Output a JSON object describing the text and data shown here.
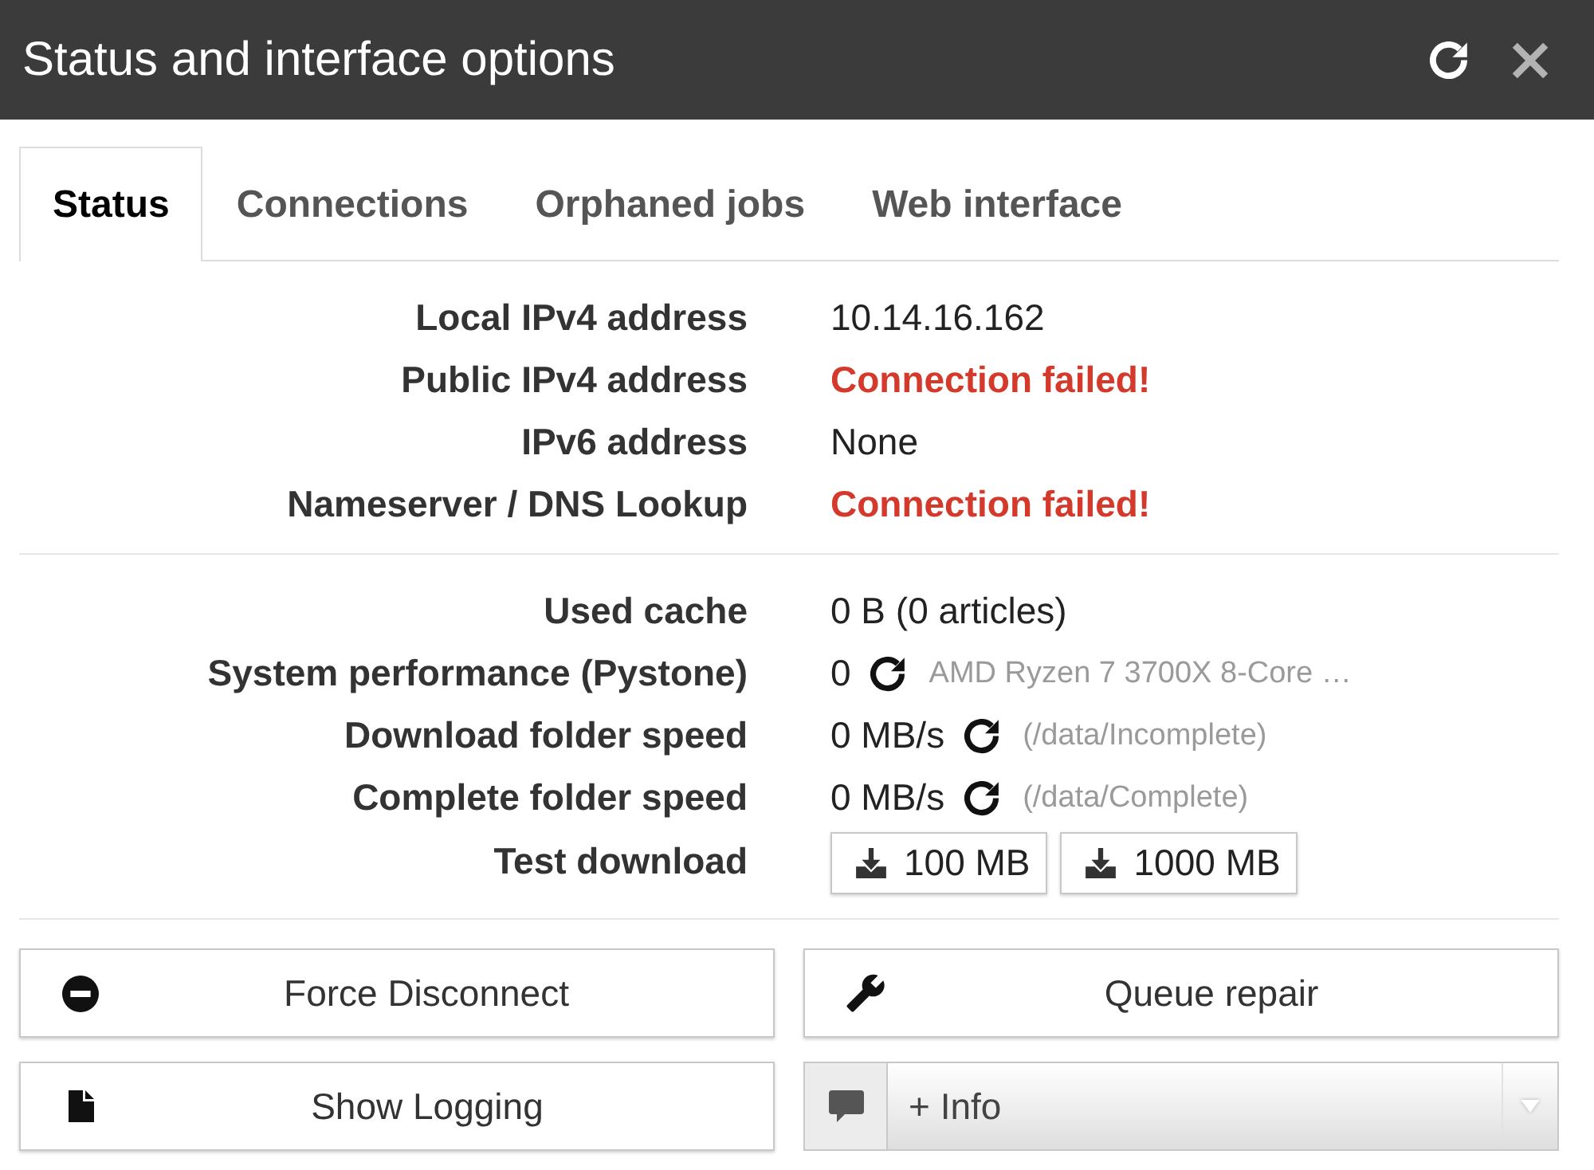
{
  "window": {
    "title": "Status and interface options"
  },
  "tabs": [
    {
      "label": "Status",
      "selected": true
    },
    {
      "label": "Connections",
      "selected": false
    },
    {
      "label": "Orphaned jobs",
      "selected": false
    },
    {
      "label": "Web interface",
      "selected": false
    }
  ],
  "network": [
    {
      "label": "Local IPv4 address",
      "kind": "text",
      "value": "10.14.16.162"
    },
    {
      "label": "Public IPv4 address",
      "kind": "error",
      "value": "Connection failed!"
    },
    {
      "label": "IPv6 address",
      "kind": "text",
      "value": "None"
    },
    {
      "label": "Nameserver / DNS Lookup",
      "kind": "error",
      "value": "Connection failed!"
    }
  ],
  "performance": [
    {
      "label": "Used cache",
      "kind": "text",
      "value": "0 B (0 articles)"
    },
    {
      "label": "System performance (Pystone)",
      "kind": "measure",
      "value": "0",
      "detail": "AMD Ryzen 7 3700X 8-Core …"
    },
    {
      "label": "Download folder speed",
      "kind": "measure",
      "value": "0 MB/s",
      "detail": "(/data/Incomplete)"
    },
    {
      "label": "Complete folder speed",
      "kind": "measure",
      "value": "0 MB/s",
      "detail": "(/data/Complete)"
    },
    {
      "label": "Test download",
      "kind": "downloads",
      "buttons": [
        "100 MB",
        "1000 MB"
      ]
    }
  ],
  "actions": [
    {
      "kind": "button",
      "label": "Force Disconnect"
    },
    {
      "kind": "button",
      "label": "Queue repair"
    },
    {
      "kind": "button",
      "label": "Show Logging"
    },
    {
      "kind": "select",
      "value": "+ Info"
    }
  ]
}
